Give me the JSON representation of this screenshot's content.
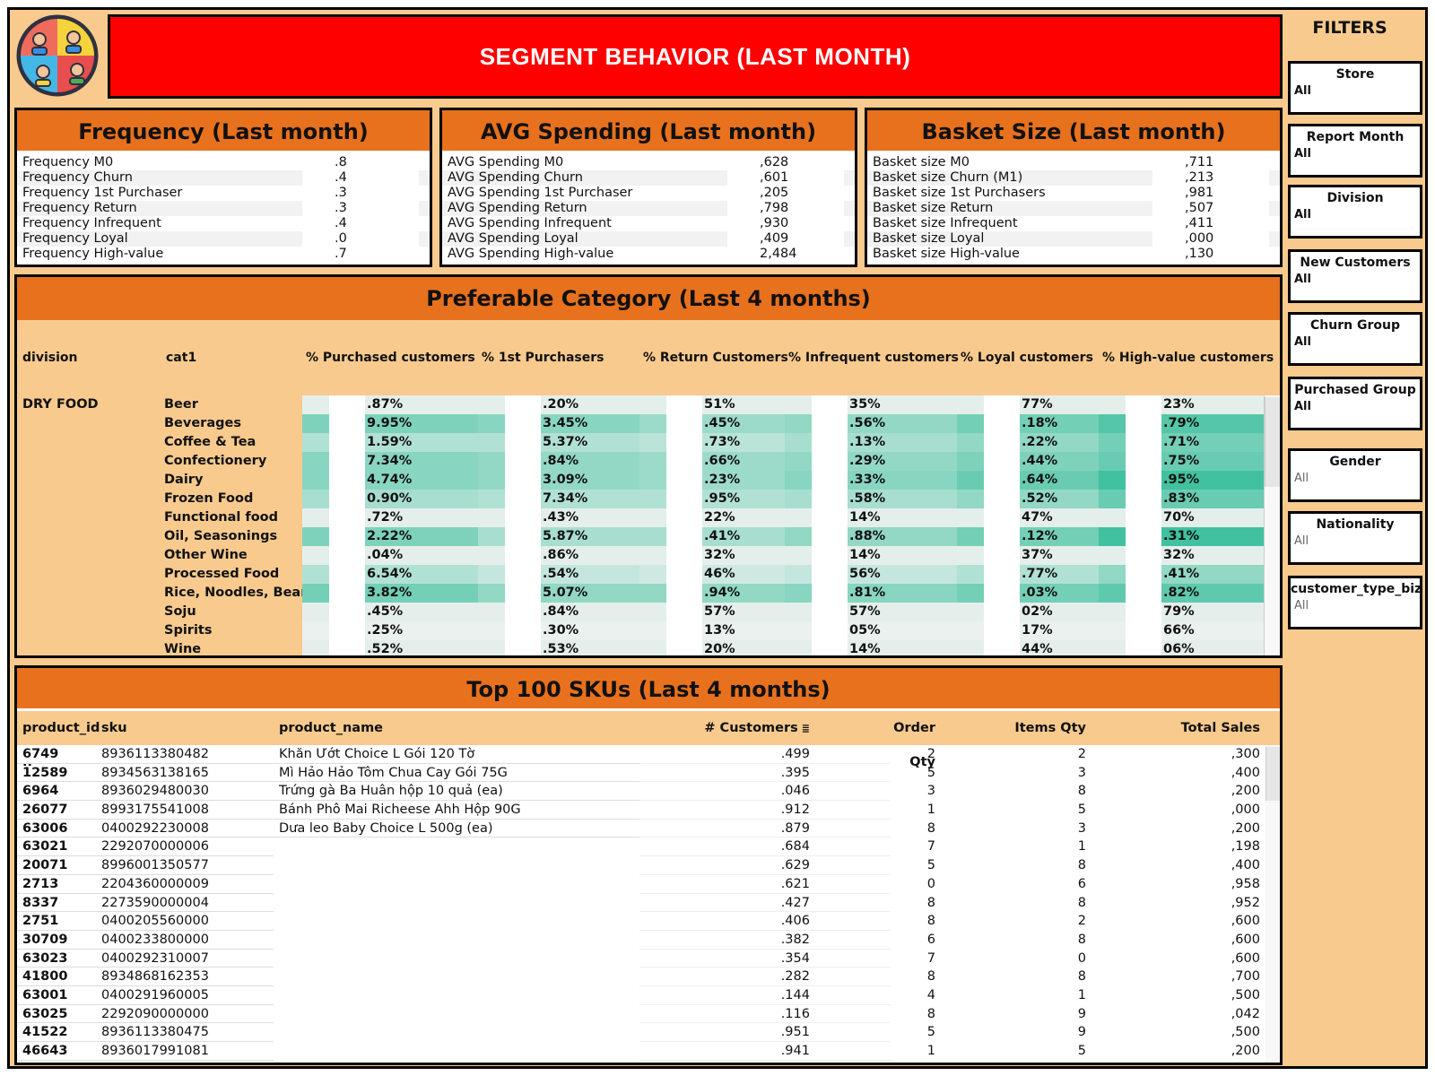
{
  "title": "SEGMENT BEHAVIOR (LAST MONTH)",
  "logo_icon": "customer-segments-icon",
  "kpis": [
    {
      "title": "Frequency (Last month)",
      "rows": [
        {
          "label": "Frequency M0",
          "value": ".8"
        },
        {
          "label": "Frequency Churn",
          "value": ".4"
        },
        {
          "label": "Frequency 1st Purchaser",
          "value": ".3"
        },
        {
          "label": "Frequency Return",
          "value": ".3"
        },
        {
          "label": "Frequency Infrequent",
          "value": ".4"
        },
        {
          "label": "Frequency Loyal",
          "value": ".0"
        },
        {
          "label": "Frequency High-value",
          "value": ".7"
        }
      ]
    },
    {
      "title": "AVG Spending (Last month)",
      "rows": [
        {
          "label": "AVG Spending M0",
          "value": ",628"
        },
        {
          "label": "AVG Spending Churn",
          "value": ",601"
        },
        {
          "label": "AVG Spending 1st Purchaser",
          "value": ",205"
        },
        {
          "label": "AVG Spending Return",
          "value": ",798"
        },
        {
          "label": "AVG Spending Infrequent",
          "value": ",930"
        },
        {
          "label": "AVG Spending Loyal",
          "value": ",409"
        },
        {
          "label": "AVG Spending High-value",
          "value": "2,484"
        }
      ]
    },
    {
      "title": "Basket Size (Last month)",
      "rows": [
        {
          "label": "Basket size M0",
          "value": ",711"
        },
        {
          "label": "Basket size Churn (M1)",
          "value": ",213"
        },
        {
          "label": "Basket size 1st Purchasers",
          "value": ",981"
        },
        {
          "label": "Basket size Return",
          "value": ",507"
        },
        {
          "label": "Basket size Infrequent",
          "value": ",411"
        },
        {
          "label": "Basket size Loyal",
          "value": ",000"
        },
        {
          "label": "Basket size High-value",
          "value": ",130"
        }
      ]
    }
  ],
  "category": {
    "title": "Preferable Category (Last 4 months)",
    "headers": [
      "division",
      "cat1",
      "% Purchased customers",
      "% 1st Purchasers",
      "% Return Customers",
      "% Infrequent customers",
      "% Loyal customers",
      "% High-value customers"
    ],
    "division": "DRY FOOD",
    "rows": [
      {
        "cat": "Beer",
        "vals": [
          ".87%",
          ".20%",
          "51%",
          "35%",
          "77%",
          "23%"
        ],
        "lvl": [
          0.05,
          0.05,
          0.05,
          0.05,
          0.05,
          0.05
        ]
      },
      {
        "cat": "Beverages",
        "vals": [
          "9.95%",
          "3.45%",
          ".45%",
          ".56%",
          ".18%",
          ".79%"
        ],
        "lvl": [
          0.55,
          0.5,
          0.4,
          0.45,
          0.6,
          0.75
        ]
      },
      {
        "cat": "Coffee & Tea",
        "vals": [
          "1.59%",
          "5.37%",
          ".73%",
          ".13%",
          ".22%",
          ".71%"
        ],
        "lvl": [
          0.3,
          0.3,
          0.25,
          0.35,
          0.45,
          0.6
        ]
      },
      {
        "cat": "Confectionery",
        "vals": [
          "7.34%",
          ".84%",
          ".66%",
          ".29%",
          ".44%",
          ".75%"
        ],
        "lvl": [
          0.5,
          0.45,
          0.4,
          0.45,
          0.55,
          0.65
        ]
      },
      {
        "cat": "Dairy",
        "vals": [
          "4.74%",
          "3.09%",
          ".23%",
          ".33%",
          ".64%",
          ".95%"
        ],
        "lvl": [
          0.5,
          0.45,
          0.4,
          0.5,
          0.65,
          0.85
        ]
      },
      {
        "cat": "Frozen Food",
        "vals": [
          "0.90%",
          "7.34%",
          ".95%",
          ".58%",
          ".52%",
          ".83%"
        ],
        "lvl": [
          0.35,
          0.3,
          0.3,
          0.35,
          0.45,
          0.65
        ]
      },
      {
        "cat": "Functional food",
        "vals": [
          ".72%",
          ".43%",
          "22%",
          "14%",
          "47%",
          "70%"
        ],
        "lvl": [
          0.05,
          0.05,
          0.05,
          0.05,
          0.05,
          0.05
        ]
      },
      {
        "cat": "Oil, Seasonings",
        "vals": [
          "2.22%",
          "5.87%",
          ".41%",
          ".88%",
          ".12%",
          ".31%"
        ],
        "lvl": [
          0.55,
          0.35,
          0.35,
          0.45,
          0.6,
          0.85
        ]
      },
      {
        "cat": "Other Wine",
        "vals": [
          ".04%",
          ".86%",
          "32%",
          "14%",
          "37%",
          "32%"
        ],
        "lvl": [
          0.05,
          0.05,
          0.05,
          0.05,
          0.05,
          0.05
        ]
      },
      {
        "cat": "Processed Food",
        "vals": [
          "6.54%",
          ".54%",
          "46%",
          "56%",
          ".77%",
          ".41%"
        ],
        "lvl": [
          0.3,
          0.2,
          0.15,
          0.2,
          0.3,
          0.45
        ]
      },
      {
        "cat": "Rice, Noodles, Beans",
        "vals": [
          "3.82%",
          "5.07%",
          ".94%",
          ".81%",
          ".03%",
          ".82%"
        ],
        "lvl": [
          0.6,
          0.45,
          0.45,
          0.5,
          0.6,
          0.7
        ]
      },
      {
        "cat": "Soju",
        "vals": [
          ".45%",
          ".84%",
          "57%",
          "57%",
          "02%",
          "79%"
        ],
        "lvl": [
          0.05,
          0.05,
          0.05,
          0.05,
          0.05,
          0.05
        ]
      },
      {
        "cat": "Spirits",
        "vals": [
          ".25%",
          ".30%",
          "13%",
          "05%",
          "17%",
          "66%"
        ],
        "lvl": [
          0.02,
          0.02,
          0.02,
          0.02,
          0.02,
          0.02
        ]
      },
      {
        "cat": "Wine",
        "vals": [
          ".52%",
          ".53%",
          "20%",
          "14%",
          "44%",
          "06%"
        ],
        "lvl": [
          0.05,
          0.05,
          0.05,
          0.05,
          0.05,
          0.05
        ]
      }
    ]
  },
  "skus": {
    "title": "Top 100 SKUs (Last 4 months)",
    "headers": [
      "product_id ..",
      "sku",
      "product_name",
      "# Customers",
      "Order Qty",
      "Items Qty",
      "Total Sales"
    ],
    "sort_icon": "sort-descending-icon",
    "rows": [
      {
        "pid": "6749",
        "sku": "8936113380482",
        "name": "Khăn Ướt Choice L Gói 120 Tờ",
        "cust": ".499",
        "oq": "2",
        "iq": "2",
        "ts": ",300"
      },
      {
        "pid": "12589",
        "sku": "8934563138165",
        "name": "Mì Hảo Hảo Tôm Chua Cay Gói 75G",
        "cust": ".395",
        "oq": "5",
        "iq": "3",
        "ts": ",400"
      },
      {
        "pid": "6964",
        "sku": "8936029480030",
        "name": "Trứng gà Ba Huân hộp 10 quả (ea)",
        "cust": ".046",
        "oq": "3",
        "iq": "8",
        "ts": ",200"
      },
      {
        "pid": "26077",
        "sku": "8993175541008",
        "name": "Bánh Phô Mai Richeese Ahh Hộp 90G",
        "cust": ".912",
        "oq": "1",
        "iq": "5",
        "ts": ",000"
      },
      {
        "pid": "63006",
        "sku": "0400292230008",
        "name": "Dưa leo Baby Choice L 500g (ea)",
        "cust": ".879",
        "oq": "8",
        "iq": "3",
        "ts": ",200"
      },
      {
        "pid": "63021",
        "sku": "2292070000006",
        "name": "",
        "cust": ".684",
        "oq": "7",
        "iq": "1",
        "ts": ",198"
      },
      {
        "pid": "20071",
        "sku": "8996001350577",
        "name": "",
        "cust": ".629",
        "oq": "5",
        "iq": "8",
        "ts": ",400"
      },
      {
        "pid": "2713",
        "sku": "2204360000009",
        "name": "",
        "cust": ".621",
        "oq": "0",
        "iq": "6",
        "ts": ",958"
      },
      {
        "pid": "8337",
        "sku": "2273590000004",
        "name": "",
        "cust": ".427",
        "oq": "8",
        "iq": "8",
        "ts": ",952"
      },
      {
        "pid": "2751",
        "sku": "0400205560000",
        "name": "",
        "cust": ".406",
        "oq": "8",
        "iq": "2",
        "ts": ",600"
      },
      {
        "pid": "30709",
        "sku": "0400233800000",
        "name": "",
        "cust": ".382",
        "oq": "6",
        "iq": "8",
        "ts": ",600"
      },
      {
        "pid": "63023",
        "sku": "0400292310007",
        "name": "",
        "cust": ".354",
        "oq": "7",
        "iq": "0",
        "ts": ",600"
      },
      {
        "pid": "41800",
        "sku": "8934868162353",
        "name": "",
        "cust": ".282",
        "oq": "8",
        "iq": "8",
        "ts": ",700"
      },
      {
        "pid": "63001",
        "sku": "0400291960005",
        "name": "",
        "cust": ".144",
        "oq": "4",
        "iq": "1",
        "ts": ",500"
      },
      {
        "pid": "63025",
        "sku": "2292090000000",
        "name": "",
        "cust": ".116",
        "oq": "8",
        "iq": "9",
        "ts": ",042"
      },
      {
        "pid": "41522",
        "sku": "8936113380475",
        "name": "",
        "cust": ".951",
        "oq": "5",
        "iq": "9",
        "ts": ",500"
      },
      {
        "pid": "46643",
        "sku": "8936017991081",
        "name": "",
        "cust": ".941",
        "oq": "1",
        "iq": "5",
        "ts": ",200"
      }
    ]
  },
  "filters": {
    "title": "FILTERS",
    "items": [
      {
        "label": "Store",
        "value": "All",
        "light": false
      },
      {
        "label": "Report Month",
        "value": "All",
        "light": false
      },
      {
        "label": "Division",
        "value": "All",
        "light": false
      },
      {
        "label": "New Customers",
        "value": "All",
        "light": false
      },
      {
        "label": "Churn Group",
        "value": "All",
        "light": false
      },
      {
        "label": "Purchased Group",
        "value": "All",
        "light": false
      },
      {
        "label": "Gender",
        "value": "All",
        "light": true
      },
      {
        "label": "Nationality",
        "value": "All",
        "light": true
      },
      {
        "label": "customer_type_biz",
        "value": "All",
        "light": true
      }
    ]
  },
  "colors": {
    "background": "#f8ca8e",
    "banner": "#ff0000",
    "panel_header": "#e8711e",
    "heat_low": "#eef2f1",
    "heat_high": "#22b890"
  }
}
